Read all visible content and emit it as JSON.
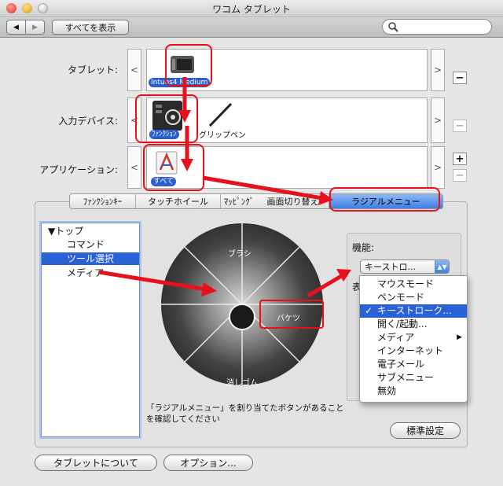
{
  "window": {
    "title": "ワコム タブレット"
  },
  "toolbar": {
    "back": "◀",
    "forward": "▶",
    "show_all": "すべてを表示",
    "search_placeholder": ""
  },
  "rows": {
    "tablet": {
      "label": "タブレット:",
      "item": "Intuos4 Medium",
      "left_arrow": "<",
      "right_arrow": ">"
    },
    "input_device": {
      "label": "入力デバイス:",
      "items": [
        "ﾌｧﾝｸｼｮﾝ",
        "グリップペン"
      ],
      "left_arrow": "<",
      "right_arrow": ">"
    },
    "application": {
      "label": "アプリケーション:",
      "item": "すべて",
      "left_arrow": "<",
      "right_arrow": ">"
    }
  },
  "side_buttons": {
    "minus1": "−",
    "minus2": "−",
    "plus": "+",
    "minus3": "−"
  },
  "tabs": [
    {
      "label": "ﾌｧﾝｸｼｮﾝｷｰ",
      "selected": false
    },
    {
      "label": "タッチホイール",
      "selected": false
    },
    {
      "label": "ﾏｯﾋﾟﾝｸﾞ",
      "selected": false
    },
    {
      "label": "画面切り替え",
      "selected": false
    },
    {
      "label": "ラジアルメニュー",
      "selected": true
    }
  ],
  "tree": {
    "root": "▼トップ",
    "children": [
      "コマンド",
      "ツール選択",
      "メディア"
    ],
    "selected": "ツール選択"
  },
  "wheel": {
    "segments": [
      "ブラシ",
      "バケツ",
      "消しゴム"
    ]
  },
  "note": "「ラジアルメニュー」を割り当てたボタンがあることを確認してください",
  "function": {
    "label": "機能:",
    "value": "キーストロ...",
    "hidden_label_prefix": "表",
    "options": [
      "マウスモード",
      "ペンモード",
      "キーストローク...",
      "開く/起動...",
      "メディア",
      "インターネット",
      "電子メール",
      "サブメニュー",
      "無効"
    ],
    "checked": "キーストローク...",
    "check_mark": "✓",
    "submenu_arrow": "▶"
  },
  "buttons": {
    "default": "標準設定",
    "about": "タブレットについて",
    "options": "オプション..."
  },
  "colors": {
    "highlight": "#2a62d6",
    "annotation": "#e8101c"
  }
}
